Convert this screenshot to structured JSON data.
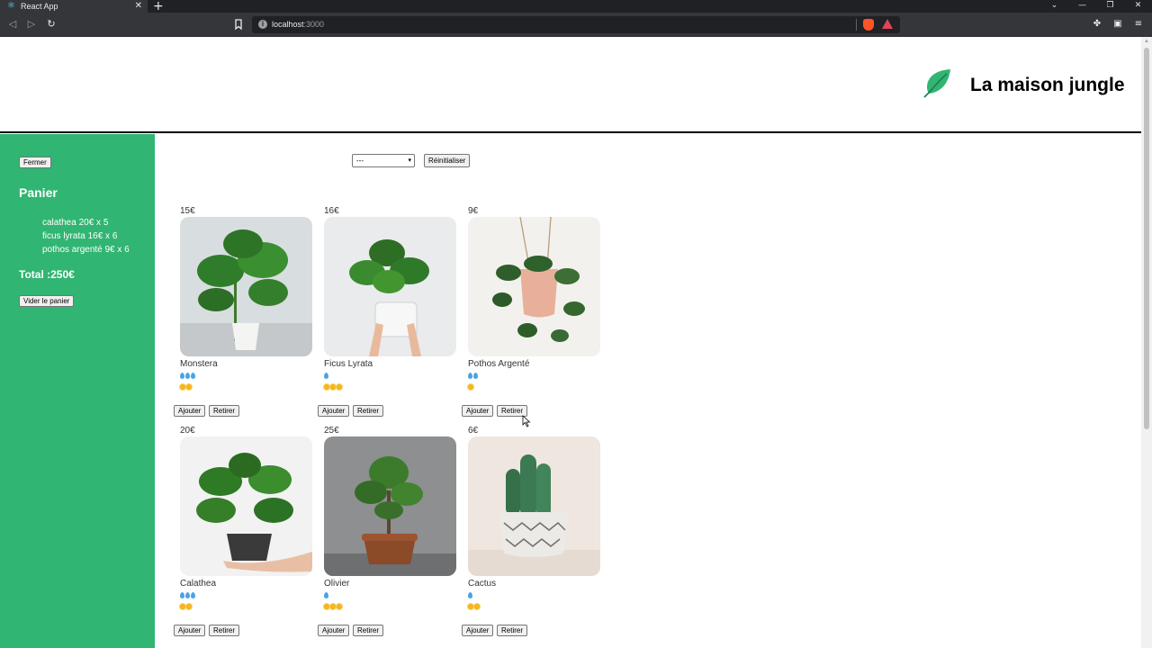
{
  "browser": {
    "tab_title": "React App",
    "tab_close": "✕",
    "new_tab": "+",
    "url_host": "localhost",
    "url_port": ":3000",
    "info_glyph": "i",
    "window_controls": [
      "⌄",
      "—",
      "❐",
      "✕"
    ]
  },
  "banner": {
    "title": "La maison jungle",
    "leaf_color": "#31b572"
  },
  "cart": {
    "background": "#31b572",
    "close_label": "Fermer",
    "title": "Panier",
    "items": [
      {
        "text": "calathea 20€ x 5"
      },
      {
        "text": "ficus lyrata 16€ x 6"
      },
      {
        "text": "pothos argenté 9€ x 6"
      }
    ],
    "total": "Total :250€",
    "empty_label": "Vider le panier"
  },
  "filters": {
    "selected": "---",
    "reset_label": "Réinitialiser"
  },
  "plants": [
    {
      "price": "15€",
      "name": "Monstera",
      "water": 3,
      "light": 2,
      "add_label": "Ajouter",
      "remove_label": "Retirer"
    },
    {
      "price": "16€",
      "name": "Ficus Lyrata",
      "water": 1,
      "light": 3,
      "add_label": "Ajouter",
      "remove_label": "Retirer"
    },
    {
      "price": "9€",
      "name": "Pothos Argenté",
      "water": 2,
      "light": 1,
      "add_label": "Ajouter",
      "remove_label": "Retirer"
    },
    {
      "price": "20€",
      "name": "Calathea",
      "water": 3,
      "light": 2,
      "add_label": "Ajouter",
      "remove_label": "Retirer"
    },
    {
      "price": "25€",
      "name": "Olivier",
      "water": 1,
      "light": 3,
      "add_label": "Ajouter",
      "remove_label": "Retirer"
    },
    {
      "price": "6€",
      "name": "Cactus",
      "water": 1,
      "light": 2,
      "add_label": "Ajouter",
      "remove_label": "Retirer"
    }
  ],
  "colors": {
    "water_drop": "#4aa3e6",
    "sun": "#f5b51f"
  }
}
